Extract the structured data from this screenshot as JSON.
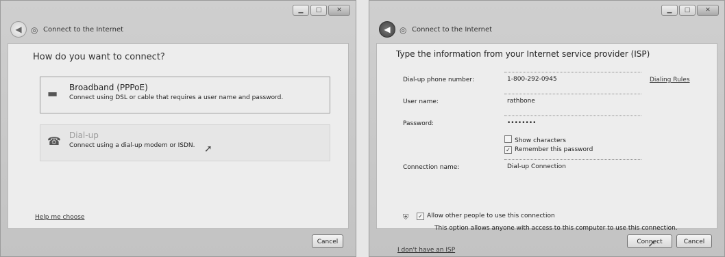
{
  "window1": {
    "title": "Connect to the Internet",
    "heading": "How do you want to connect?",
    "options": [
      {
        "title": "Broadband (PPPoE)",
        "desc": "Connect using DSL or cable that requires a user name and password.",
        "icon": "broadband-modem-icon"
      },
      {
        "title": "Dial-up",
        "desc": "Connect using a dial-up modem or ISDN.",
        "icon": "dialup-phone-icon"
      }
    ],
    "help_link": "Help me choose",
    "cancel_label": "Cancel"
  },
  "window2": {
    "title": "Connect to the Internet",
    "heading": "Type the information from your Internet service provider (ISP)",
    "phone_label": "Dial-up phone number:",
    "phone_value": "1-800-292-0945",
    "dialing_rules": "Dialing Rules",
    "username_label": "User name:",
    "username_value": "rathbone",
    "password_label": "Password:",
    "password_value": "••••••••",
    "show_chars": "Show characters",
    "show_chars_checked": false,
    "remember_pw": "Remember this password",
    "remember_pw_checked": true,
    "conn_name_label": "Connection name:",
    "conn_name_value": "Dial-up Connection",
    "allow_label": "Allow other people to use this connection",
    "allow_checked": true,
    "allow_desc": "This option allows anyone with access to this computer to use this connection.",
    "no_isp_link": "I don't have an ISP",
    "connect_label": "Connect",
    "cancel_label": "Cancel"
  }
}
